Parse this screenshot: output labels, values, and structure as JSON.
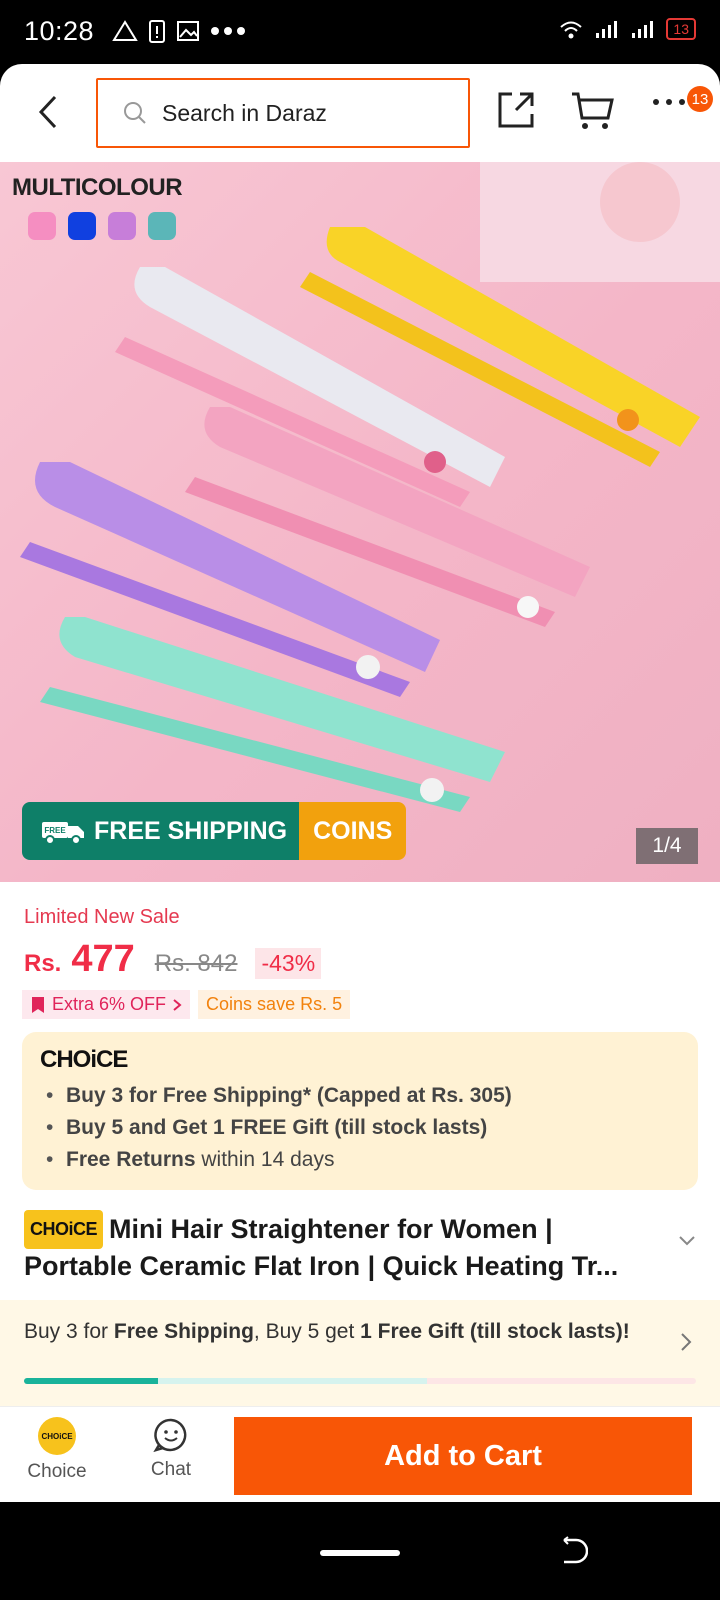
{
  "status": {
    "time": "10:28",
    "battery": "13"
  },
  "header": {
    "search_placeholder": "Search in Daraz",
    "more_badge": "13"
  },
  "hero": {
    "label": "MULTICOLOUR",
    "swatches": [
      "#f58ec1",
      "#1040e0",
      "#c77ed9",
      "#5bb6b8"
    ],
    "free_shipping": "FREE SHIPPING",
    "free_badge": "FREE",
    "coins": "COINS",
    "pager": "1/4"
  },
  "product": {
    "limited_sale": "Limited New Sale",
    "currency": "Rs.",
    "price": "477",
    "old_price": "Rs. 842",
    "discount": "-43%",
    "extra_off": "Extra 6% OFF",
    "coins_save": "Coins save Rs. 5",
    "choice_logo": "CHOiCE",
    "choice_points": [
      {
        "bold": "Buy 3 for  Free Shipping* (Capped at Rs. 305)",
        "rest": ""
      },
      {
        "bold": "Buy 5 and Get 1 FREE Gift (till stock lasts)",
        "rest": ""
      },
      {
        "bold": "Free Returns",
        "rest": " within 14 days"
      }
    ],
    "choice_tag": "CHOiCE",
    "title": "Mini Hair Straightener for Women | Portable Ceramic Flat Iron | Quick Heating Tr..."
  },
  "promo_banner": {
    "t1": "Buy 3 for ",
    "b1": "Free Shipping",
    "t2": ", Buy 5 get ",
    "b2": "1 Free Gift (till stock lasts)!",
    "progress_fraction": 0.2
  },
  "bottom": {
    "choice": "Choice",
    "choice_icon": "CHOiCE",
    "chat": "Chat",
    "add_to_cart": "Add to Cart"
  }
}
